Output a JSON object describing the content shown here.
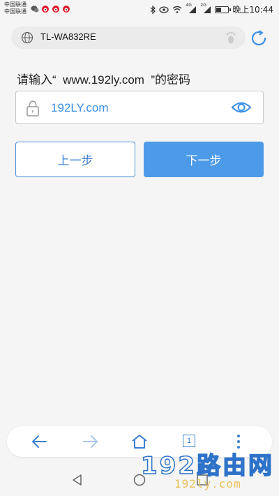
{
  "statusbar": {
    "carrier_line1": "中国联通",
    "carrier_line2": "中国联通",
    "time": "晚上10:44",
    "network_4g": "4G",
    "network_2g": "2G",
    "battery_level": 0.35,
    "icons": [
      "wechat-icon",
      "weibo-icon",
      "weibo-icon",
      "weibo-icon",
      "bluetooth-icon",
      "eye-comfort-icon",
      "wifi-icon",
      "signal-icon",
      "signal-icon",
      "battery-icon"
    ]
  },
  "urlbar": {
    "url": "TL-WA832RE"
  },
  "content": {
    "prompt_text": "请输入“  www.192ly.com  ”的密码",
    "password_value": "192LY.com",
    "prev_button": "上一步",
    "next_button": "下一步"
  },
  "bottom_nav": {
    "tab_count": "1"
  },
  "watermark": {
    "big": "192路由网",
    "small": "192ly.com"
  },
  "colors": {
    "accent": "#4d9be8",
    "link_text": "#3a8ee6",
    "background": "#f5f5f5"
  }
}
